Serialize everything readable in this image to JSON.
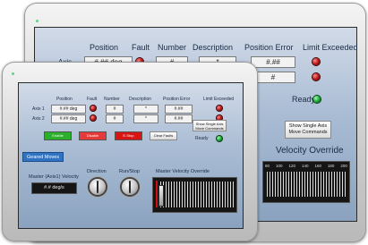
{
  "front": {
    "headers": {
      "position": "Position",
      "fault": "Fault",
      "number": "Number",
      "description": "Description",
      "position_error": "Position Error",
      "limit_exceeded": "Limit Exceeded"
    },
    "axes": [
      {
        "label": "Axis 1",
        "position": "#.## deg",
        "number": "#",
        "description": "*",
        "position_error": "#.##"
      },
      {
        "label": "Axis 2",
        "position": "#.## deg",
        "number": "#",
        "description": "*",
        "position_error": "#.##"
      }
    ],
    "buttons": {
      "enable": "Enable",
      "disable": "Disable",
      "e_stop": "E-Stop",
      "clear_faults": "Clear Faults",
      "show_single_axis": "Show Single Axis Move Commands"
    },
    "ready_label": "Ready",
    "geared_moves_tab": "Geared Moves",
    "master_velocity": {
      "label": "Master (Axis1) Velocity",
      "value": "#.# deg/s"
    },
    "direction_label": "Direction",
    "run_stop_label": "Run/Stop",
    "master_velocity_override": {
      "label": "Master Velocity Override",
      "value_percent": 0
    }
  },
  "back": {
    "headers": {
      "position": "Position",
      "fault": "Fault",
      "number": "Number",
      "description": "Description",
      "position_error": "Position Error",
      "limit_exceeded": "Limit Exceeded"
    },
    "axis_label": "Axis",
    "row1": {
      "position": "#.## deg",
      "number": "#",
      "description": "*",
      "position_error": "#.##"
    },
    "row2": {
      "position_error": "#"
    },
    "ready_label": "Ready",
    "show_single_axis": "Show Single Axis Move Commands",
    "velocity_override_label": "Velocity Override",
    "scale": [
      "80",
      "100",
      "120",
      "140",
      "160",
      "180",
      "200"
    ]
  },
  "colors": {
    "enable_green": "#2bb02b",
    "disable_red": "#e63a3a",
    "estop_red": "#d81414",
    "tab_blue": "#2f73c2"
  }
}
